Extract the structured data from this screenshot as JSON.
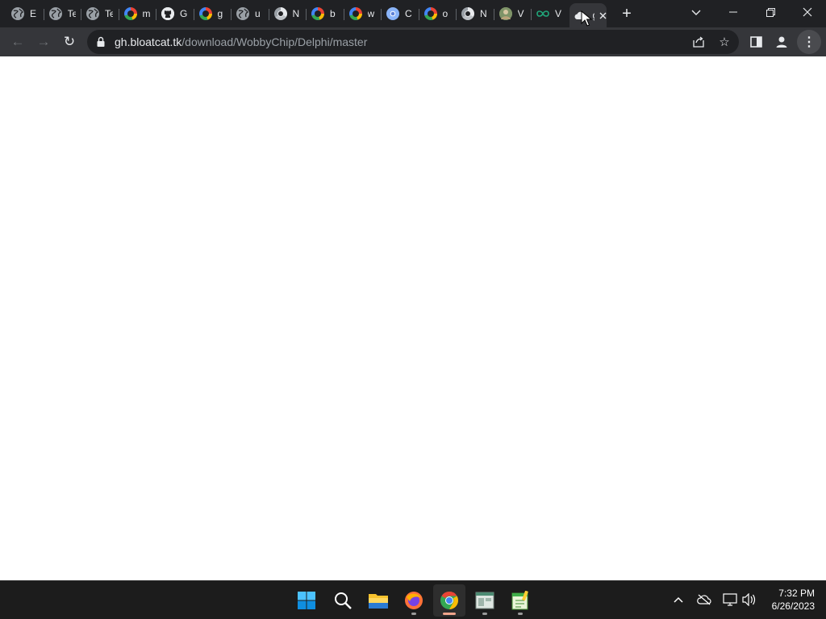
{
  "browser": {
    "tabs": [
      {
        "title": "E",
        "favicon": "globe-icon",
        "icon_type": "globe"
      },
      {
        "title": "Te",
        "favicon": "globe-icon",
        "icon_type": "globe"
      },
      {
        "title": "Te",
        "favicon": "globe-icon",
        "icon_type": "globe"
      },
      {
        "title": "m",
        "favicon": "google-icon",
        "icon_type": "google"
      },
      {
        "title": "G",
        "favicon": "github-icon",
        "icon_type": "github"
      },
      {
        "title": "g",
        "favicon": "google-icon",
        "icon_type": "google"
      },
      {
        "title": "u",
        "favicon": "globe-icon",
        "icon_type": "globe"
      },
      {
        "title": "N",
        "favicon": "chrome-icon",
        "icon_type": "chrome"
      },
      {
        "title": "b",
        "favicon": "google-icon",
        "icon_type": "google"
      },
      {
        "title": "w",
        "favicon": "google-icon",
        "icon_type": "google"
      },
      {
        "title": "C",
        "favicon": "chromium-icon",
        "icon_type": "chromium"
      },
      {
        "title": "o",
        "favicon": "google-icon",
        "icon_type": "google"
      },
      {
        "title": "N",
        "favicon": "chrome-icon",
        "icon_type": "chrome"
      },
      {
        "title": "V",
        "favicon": "avatar-icon",
        "icon_type": "avatar"
      },
      {
        "title": "V",
        "favicon": "infinity-icon",
        "icon_type": "infinity"
      }
    ],
    "active_tab": {
      "title": "g",
      "favicon": "cloud-icon",
      "close_glyph": "✕"
    },
    "new_tab_glyph": "+",
    "tab_search_glyph": "⌄",
    "window_controls": {
      "minimize": "—",
      "restore": "❐",
      "close": "✕"
    }
  },
  "toolbar": {
    "back_glyph": "←",
    "forward_glyph": "→",
    "reload_glyph": "↻",
    "url_host": "gh.bloatcat.tk",
    "url_path": "/download/WobbyChip/Delphi/master",
    "share_glyph": "⇪",
    "bookmark_glyph": "☆",
    "side_panel_glyph": "▣",
    "profile_glyph": "👤",
    "menu_glyph": "⋮"
  },
  "taskbar": {
    "apps": [
      {
        "name": "start-button",
        "icon": "windows-icon",
        "active": false
      },
      {
        "name": "search-button",
        "icon": "search-icon",
        "active": false
      },
      {
        "name": "file-explorer-button",
        "icon": "folder-icon",
        "active": false
      },
      {
        "name": "firefox-button",
        "icon": "firefox-icon",
        "active": false
      },
      {
        "name": "chrome-button",
        "icon": "chrome-icon",
        "active": true
      },
      {
        "name": "app-window-button",
        "icon": "window-icon",
        "active": false
      },
      {
        "name": "notepad-button",
        "icon": "notepad-icon",
        "active": false
      }
    ],
    "tray": {
      "chevron_glyph": "⌃",
      "cloud_off_glyph": "☁",
      "network_glyph": "🖥",
      "volume_glyph": "🔊"
    },
    "clock": {
      "time": "7:32 PM",
      "date": "6/26/2023"
    }
  },
  "colors": {
    "tabstrip_bg": "#202124",
    "toolbar_bg": "#35363a",
    "omnibox_bg": "#202124",
    "content_bg": "#ffffff",
    "taskbar_bg": "#1c1c1c",
    "active_indicator": "#f1a58c"
  }
}
